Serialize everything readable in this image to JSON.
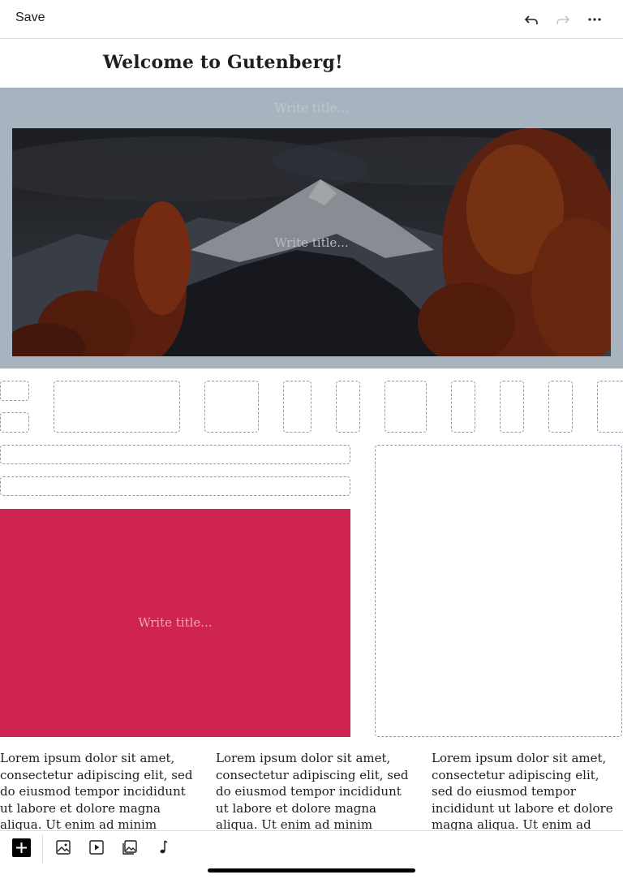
{
  "toolbar": {
    "save_label": "Save",
    "undo_icon": "undo-icon",
    "redo_icon": "redo-icon",
    "more_icon": "more-horizontal-icon"
  },
  "post": {
    "title": "Welcome to Gutenberg!"
  },
  "cover_block": {
    "outer_placeholder": "Write title...",
    "inner_placeholder": "Write title...",
    "image_subject": "mountain-autumn-trees"
  },
  "red_cover": {
    "placeholder": "Write title...",
    "color": "#cf2451"
  },
  "columns": [
    {
      "text": "Lorem ipsum dolor sit amet, consectetur adipiscing elit, sed do eiusmod tempor incididunt ut labore et dolore magna aliqua. Ut enim ad minim veniam, quis"
    },
    {
      "text": "Lorem ipsum dolor sit amet, consectetur adipiscing elit, sed do eiusmod tempor incididunt ut labore et dolore magna aliqua. Ut enim ad minim veniam, quis"
    },
    {
      "text": "Lorem ipsum dolor sit amet, consectetur adipiscing elit, sed do eiusmod tempor incididunt ut labore et dolore magna aliqua. Ut enim ad minim"
    }
  ],
  "bottom_toolbar": {
    "items": [
      "add-block-icon",
      "image-icon",
      "video-icon",
      "gallery-icon",
      "audio-icon"
    ]
  },
  "colors": {
    "cover_bg": "#a7b4c0",
    "dashed_border": "#8c9aaa",
    "text": "#1e1e1e"
  }
}
